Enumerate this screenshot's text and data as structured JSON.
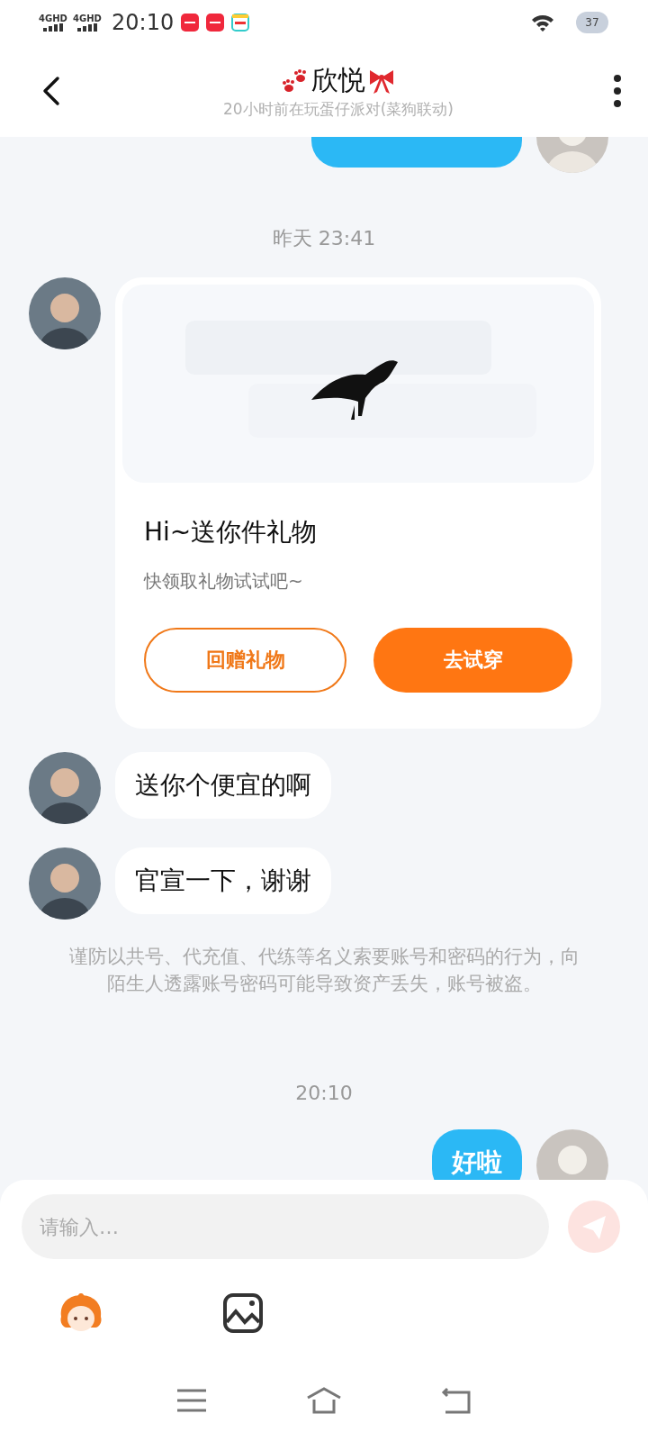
{
  "status_bar": {
    "networks": [
      "4GHD",
      "4GHD"
    ],
    "time": "20:10",
    "battery": "37"
  },
  "header": {
    "title": "欣悦",
    "subtitle": "20小时前在玩蛋仔派对(菜狗联动)"
  },
  "messages": [
    {
      "kind": "text",
      "outgoing": true
    },
    {
      "kind": "time",
      "text": "昨天 23:41"
    },
    {
      "kind": "gift",
      "outgoing": false,
      "title": "Hi~送你件礼物",
      "subtitle": "快领取礼物试试吧~",
      "buttons": [
        {
          "label": "回赠礼物",
          "kind": "outline"
        },
        {
          "label": "去试穿",
          "kind": "filled"
        }
      ]
    },
    {
      "kind": "text",
      "outgoing": false,
      "text": "送你个便宜的啊"
    },
    {
      "kind": "text",
      "outgoing": false,
      "text": "官宣一下，谢谢"
    },
    {
      "kind": "notice",
      "text": "谨防以共号、代充值、代练等名义索要账号和密码的行为，向陌生人透露账号密码可能导致资产丢失，账号被盗。"
    },
    {
      "kind": "time",
      "text": "20:10"
    },
    {
      "kind": "text",
      "outgoing": true,
      "text": "好啦"
    }
  ],
  "composer": {
    "placeholder": "请输入…"
  }
}
